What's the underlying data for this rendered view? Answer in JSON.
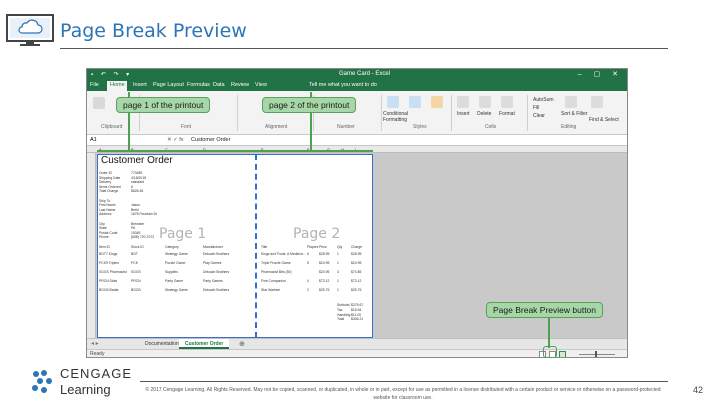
{
  "slide": {
    "title": "Page Break Preview",
    "page_number": "42",
    "footer": "© 2017 Cengage Learning. All Rights Reserved. May not be copied, scanned, or duplicated, in whole or in part, except for use as permitted in a license distributed with a certain product or service or otherwise on a password-protected website for classroom use.",
    "logo_line1": "CENGAGE",
    "logo_line2": "Learning",
    "accent_color": "#2e75b6"
  },
  "excel": {
    "window_title": "Game Card - Excel",
    "tell_me": "Tell me what you want to do",
    "menu": [
      "File",
      "Home",
      "Insert",
      "Page Layout",
      "Formulas",
      "Data",
      "Review",
      "View"
    ],
    "ribbon_groups": [
      "Clipboard",
      "Font",
      "Alignment",
      "Number",
      "Styles",
      "Cells",
      "Editing"
    ],
    "ribbon_buttons": {
      "conditional": "Conditional Formatting",
      "format_table": "Format as Table",
      "cell_styles": "Cell Styles",
      "insert": "Insert",
      "delete": "Delete",
      "format": "Format",
      "autosum": "AutoSum",
      "fill": "Fill",
      "clear": "Clear",
      "sort_filter": "Sort & Filter",
      "find_select": "Find & Select"
    },
    "name_box": "A1",
    "formula": "Customer Order",
    "columns": [
      "A",
      "B",
      "C",
      "D",
      "E",
      "F",
      "G",
      "H",
      "I"
    ],
    "sheet_title": "Customer Order",
    "page1_label": "Page 1",
    "page2_label": "Page 2",
    "left_labels": [
      "Order ID",
      "Shipping Date",
      "Delivery",
      "Items Ordered",
      "Total Charge",
      "",
      "Ship To",
      "First Name",
      "Last Name",
      "Address",
      "",
      "City",
      "State",
      "Postal Code",
      "Phone"
    ],
    "left_values": [
      "770489",
      "4/18/2018",
      "standard",
      "6",
      "$626.46",
      "",
      "",
      "Jason",
      "Brehl",
      "1678 Fountain Dr",
      "",
      "Brewster",
      "PA",
      "19345",
      "(608) 720-7072"
    ],
    "table_headers": [
      "Item ID",
      "Stock ID",
      "Category",
      "Manufacturer",
      "Title",
      "Players",
      "Price",
      "Qty",
      "Charge"
    ],
    "table_rows": [
      [
        "BGT7 Kings",
        "BGT",
        "Strategy Game",
        "Deloach Brothers",
        "Kings and Fools: A Medieval Game of Knights, Traveller, and Rule",
        "6",
        "$28.95",
        "1",
        "$28.95"
      ],
      [
        "PCK9 Triples",
        "PCK",
        "Puzzle Game",
        "Play Games",
        "Triple Puzzle Game",
        "5",
        "$24.95",
        "1",
        "$24.95"
      ],
      [
        "SGGS Pharmacist",
        "SGGS",
        "Supplies",
        "Deloach Brothers",
        "Pharmacist Bits (50)",
        "",
        "$24.95",
        "3",
        "$74.85"
      ],
      [
        "PRCN Slots",
        "PRCN",
        "Party Game",
        "Party Games",
        "Fine Companion",
        "4",
        "$73.12",
        "1",
        "$73.12"
      ],
      [
        "BGCB Badar",
        "BGCB",
        "Strategy Game",
        "Deloach Brothers",
        "Star Warfare",
        "2",
        "$25.75",
        "1",
        "$25.75"
      ]
    ],
    "totals": [
      [
        "Subtotal",
        "$275.67"
      ],
      [
        "Tax",
        "$16.54"
      ],
      [
        "Handling",
        "$11.00"
      ],
      [
        "Total",
        "$306.21"
      ]
    ],
    "sheet_tabs": [
      "Documentation",
      "Customer Order"
    ],
    "status": "Ready"
  },
  "callouts": {
    "page1": "page 1 of the printout",
    "page2": "page 2 of the printout",
    "pbp_button": "Page Break Preview button"
  }
}
